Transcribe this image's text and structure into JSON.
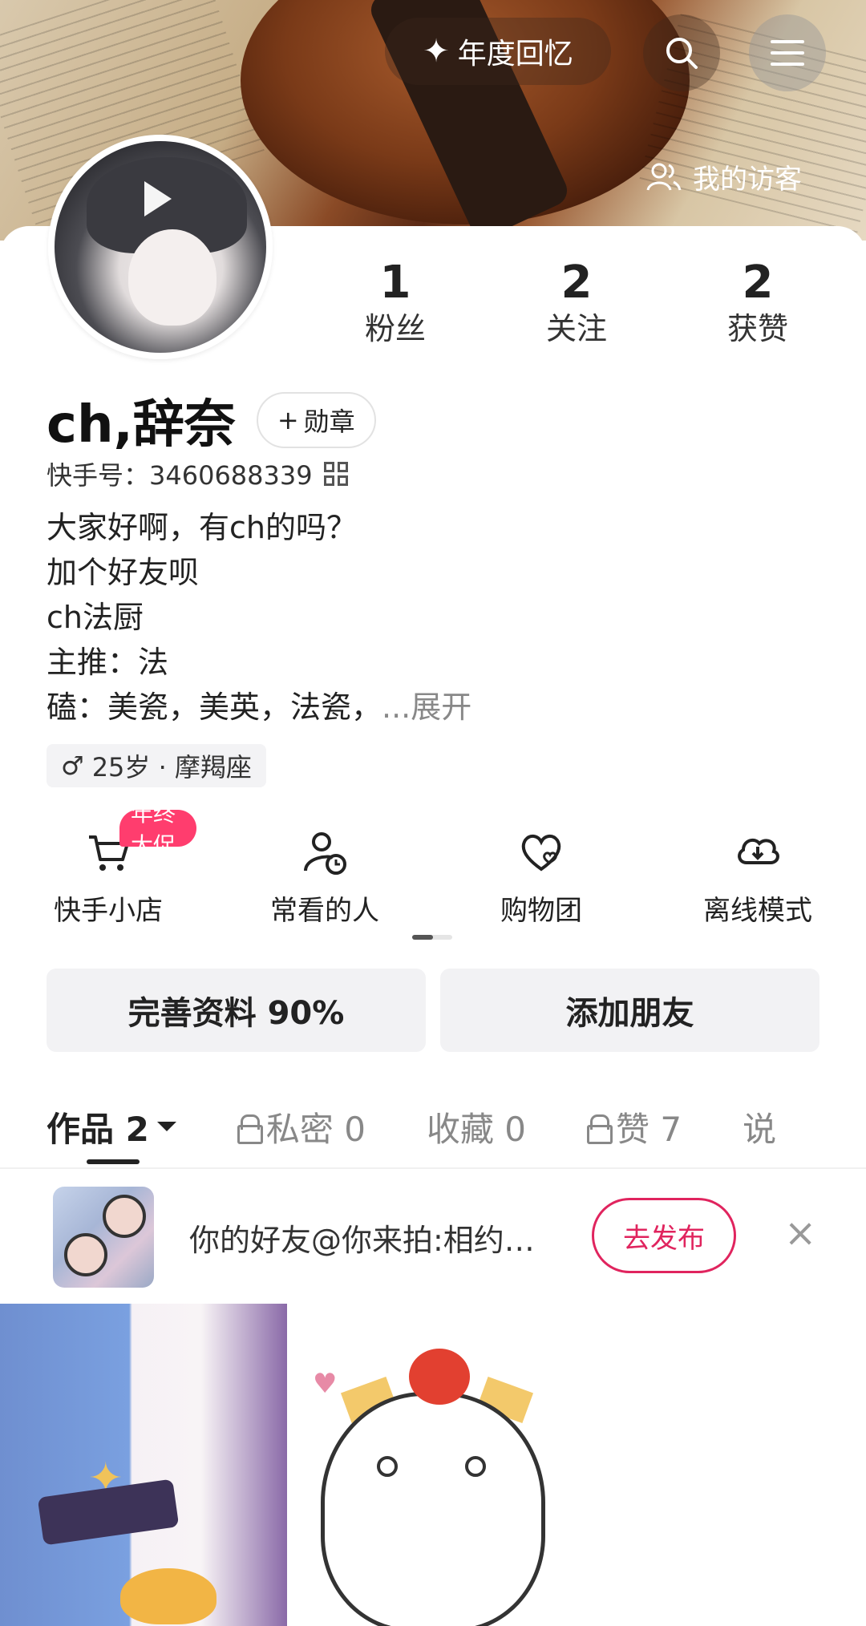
{
  "header": {
    "recap_label": "年度回忆",
    "visitors_label": "我的访客"
  },
  "stats": [
    {
      "value": "1",
      "label": "粉丝"
    },
    {
      "value": "2",
      "label": "关注"
    },
    {
      "value": "2",
      "label": "获赞"
    }
  ],
  "profile": {
    "name": "ch,辞奈",
    "medal_label": "勋章",
    "ks_id": "快手号：3460688339",
    "bio_lines": [
      "大家好啊，有ch的吗？",
      "加个好友呗",
      "ch法厨",
      "主推：法",
      "磕：美瓷，美英，法瓷，"
    ],
    "bio_expand": "...展开",
    "tag": "25岁 · 摩羯座"
  },
  "quick_links": [
    {
      "label": "快手小店",
      "icon": "cart-icon",
      "badge": "年终大促"
    },
    {
      "label": "常看的人",
      "icon": "person-clock-icon"
    },
    {
      "label": "购物团",
      "icon": "heart-group-icon"
    },
    {
      "label": "离线模式",
      "icon": "cloud-download-icon"
    }
  ],
  "actions": {
    "complete_profile": "完善资料 90%",
    "add_friend": "添加朋友"
  },
  "tabs": [
    {
      "label": "作品 2",
      "active": true
    },
    {
      "label": "私密 0",
      "locked": true
    },
    {
      "label": "收藏 0"
    },
    {
      "label": "赞 7",
      "locked": true
    },
    {
      "label": "说"
    }
  ],
  "suggestion": {
    "text": "你的好友@你来拍:相约…",
    "publish_label": "去发布",
    "close_icon": "close-icon"
  },
  "colors": {
    "accent": "#e0245e",
    "promo_badge": "#ff3d6e"
  }
}
